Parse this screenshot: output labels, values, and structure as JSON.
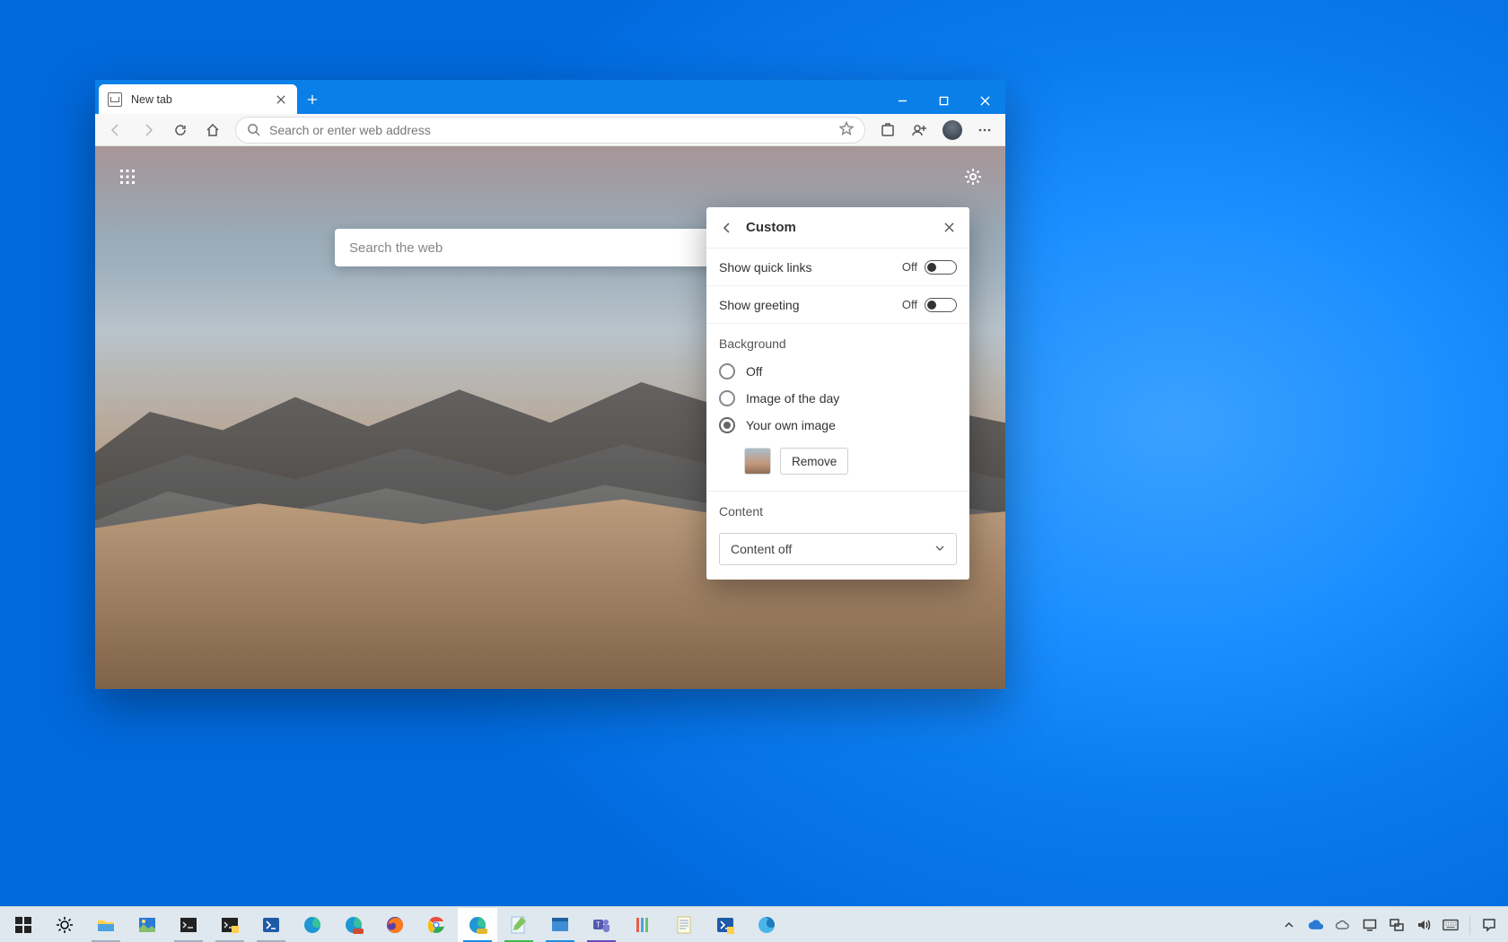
{
  "browser": {
    "tab_title": "New tab",
    "address_placeholder": "Search or enter web address"
  },
  "ntp": {
    "search_placeholder": "Search the web"
  },
  "panel": {
    "title": "Custom",
    "quick_links": {
      "label": "Show quick links",
      "state": "Off"
    },
    "greeting": {
      "label": "Show greeting",
      "state": "Off"
    },
    "background_heading": "Background",
    "background_options": {
      "off": "Off",
      "image_of_day": "Image of the day",
      "own_image": "Your own image"
    },
    "remove_label": "Remove",
    "content_heading": "Content",
    "content_value": "Content off"
  }
}
